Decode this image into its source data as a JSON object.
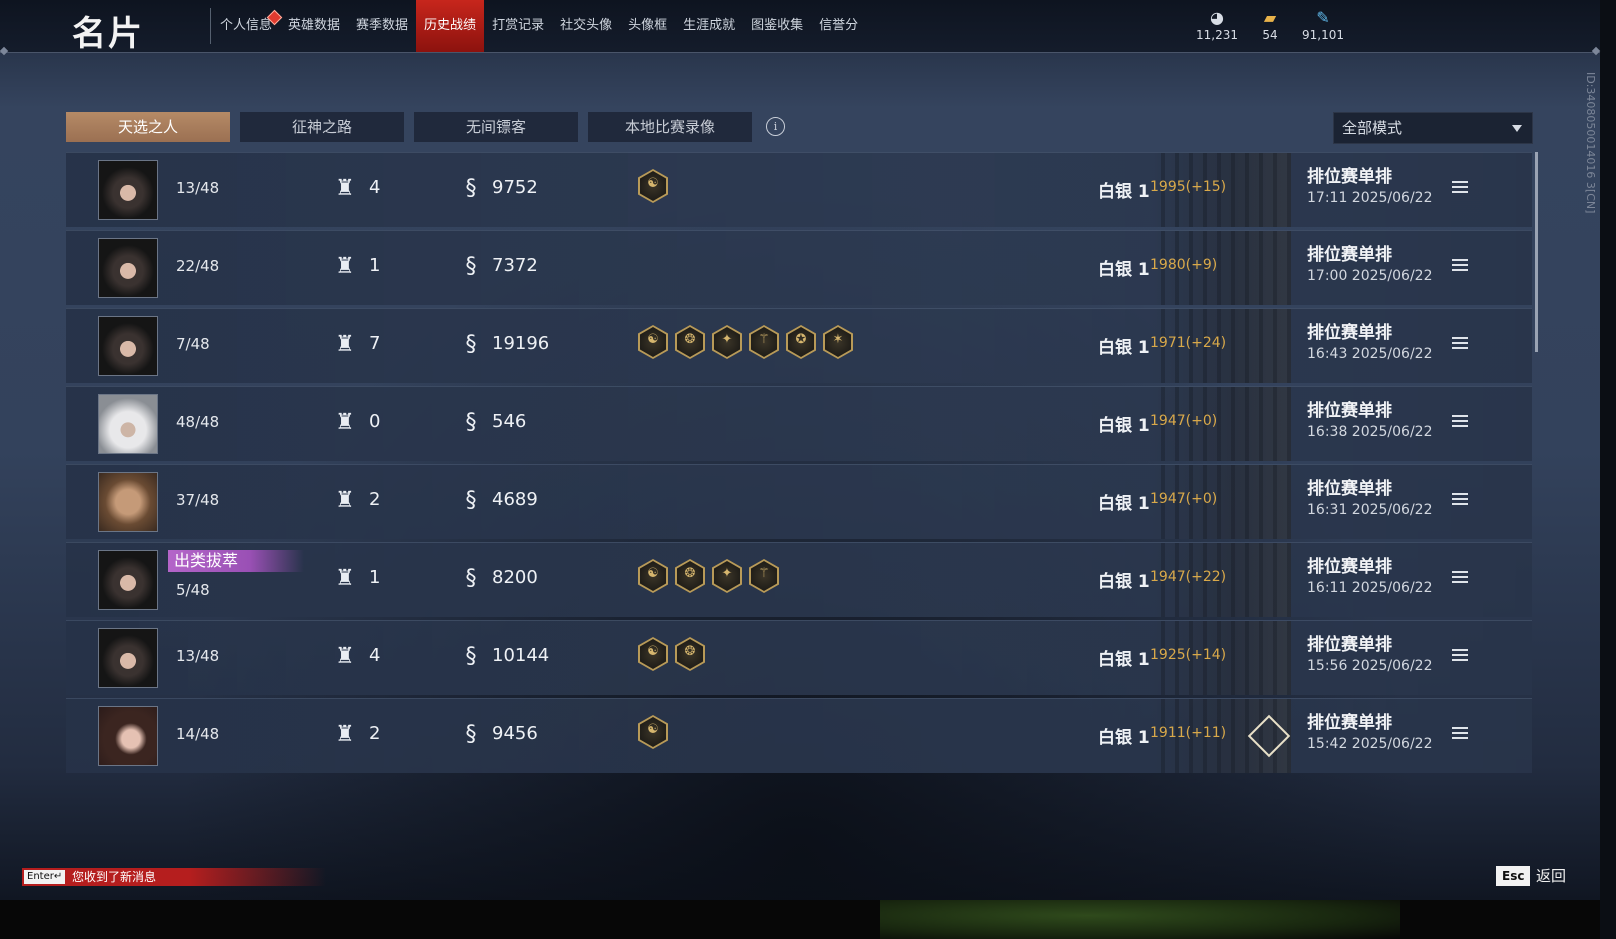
{
  "app": {
    "title": "名片"
  },
  "nav": {
    "items": [
      "个人信息",
      "英雄数据",
      "赛季数据",
      "历史战绩",
      "打赏记录",
      "社交头像",
      "头像框",
      "生涯成就",
      "图鉴收集",
      "信誉分"
    ],
    "active_index": 3
  },
  "currencies": [
    {
      "icon": "coin-icon",
      "value": "11,231"
    },
    {
      "icon": "ticket-icon",
      "value": "54"
    },
    {
      "icon": "feather-icon",
      "value": "91,101"
    }
  ],
  "player_id": "ID:3408050014016 3[CN]",
  "tabs": [
    "天选之人",
    "征神之路",
    "无间镖客",
    "本地比赛录像"
  ],
  "active_tab": 0,
  "mode_filter": {
    "selected": "全部模式"
  },
  "matches": [
    {
      "rank": "13/48",
      "honor": "",
      "kills": "4",
      "money": "9752",
      "badges": 1,
      "tier": "白银 1",
      "score": "1995(+15)",
      "mode": "排位赛单排",
      "time": "17:11  2025/06/22"
    },
    {
      "rank": "22/48",
      "honor": "",
      "kills": "1",
      "money": "7372",
      "badges": 0,
      "tier": "白银 1",
      "score": "1980(+9)",
      "mode": "排位赛单排",
      "time": "17:00  2025/06/22"
    },
    {
      "rank": "7/48",
      "honor": "",
      "kills": "7",
      "money": "19196",
      "badges": 6,
      "tier": "白银 1",
      "score": "1971(+24)",
      "mode": "排位赛单排",
      "time": "16:43  2025/06/22"
    },
    {
      "rank": "48/48",
      "honor": "",
      "kills": "0",
      "money": "546",
      "badges": 0,
      "tier": "白银 1",
      "score": "1947(+0)",
      "mode": "排位赛单排",
      "time": "16:38  2025/06/22"
    },
    {
      "rank": "37/48",
      "honor": "",
      "kills": "2",
      "money": "4689",
      "badges": 0,
      "tier": "白银 1",
      "score": "1947(+0)",
      "mode": "排位赛单排",
      "time": "16:31  2025/06/22"
    },
    {
      "rank": "5/48",
      "honor": "出类拔萃",
      "kills": "1",
      "money": "8200",
      "badges": 4,
      "tier": "白银 1",
      "score": "1947(+22)",
      "mode": "排位赛单排",
      "time": "16:11  2025/06/22"
    },
    {
      "rank": "13/48",
      "honor": "",
      "kills": "4",
      "money": "10144",
      "badges": 2,
      "tier": "白银 1",
      "score": "1925(+14)",
      "mode": "排位赛单排",
      "time": "15:56  2025/06/22"
    },
    {
      "rank": "14/48",
      "honor": "",
      "kills": "2",
      "money": "9456",
      "badges": 1,
      "tier": "白银 1",
      "score": "1911(+11)",
      "mode": "排位赛单排",
      "time": "15:42  2025/06/22"
    }
  ],
  "footer": {
    "enter_key": "Enter↵",
    "notice": "您收到了新消息",
    "esc_key": "Esc",
    "back": "返回"
  }
}
